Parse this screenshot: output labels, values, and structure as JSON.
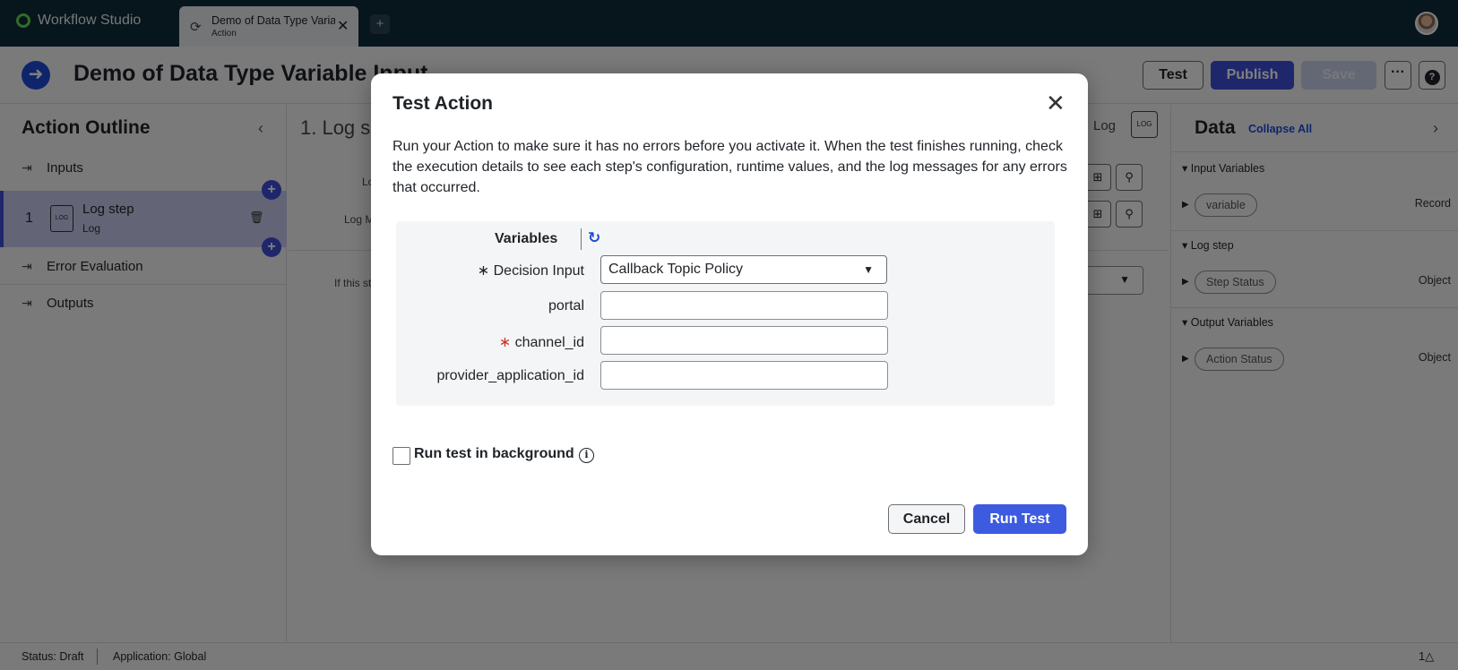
{
  "app": {
    "brand": "Workflow Studio"
  },
  "tabs": [
    {
      "title": "Demo of Data Type Variable Input",
      "subtitle": "Action"
    }
  ],
  "header": {
    "title": "Demo of Data Type Variable Input",
    "test_label": "Test",
    "publish_label": "Publish",
    "save_label": "Save",
    "more_label": "···",
    "help_label": "?"
  },
  "outline": {
    "title": "Action Outline",
    "inputs_label": "Inputs",
    "step": {
      "number": "1",
      "name": "Log step",
      "type": "Log"
    },
    "error_label": "Error Evaluation",
    "outputs_label": "Outputs"
  },
  "center": {
    "step_heading": "1.  Log s",
    "log_level_label": "Lo",
    "log_message_label": "Log M",
    "if_text": "If this st",
    "log_label": "Log"
  },
  "data_panel": {
    "title": "Data",
    "collapse_all": "Collapse All",
    "sections": [
      {
        "heading": "Input Variables",
        "var": "variable",
        "type": "Record"
      },
      {
        "heading": "Log step",
        "var": "Step Status",
        "type": "Object"
      },
      {
        "heading": "Output Variables",
        "var": "Action Status",
        "type": "Object"
      }
    ]
  },
  "status": {
    "status": "Status: Draft",
    "application": "Application: Global",
    "count": "1"
  },
  "modal": {
    "title": "Test Action",
    "description": "Run your Action to make sure it has no errors before you activate it. When the test finishes running, check the execution details to see each step's configuration, runtime values, and the log messages for any errors that occurred.",
    "variables_title": "Variables",
    "fields": {
      "decision_input": {
        "label": "Decision Input",
        "value": "Callback Topic Policy",
        "required": true
      },
      "portal": {
        "label": "portal",
        "value": ""
      },
      "channel_id": {
        "label": "channel_id",
        "value": "",
        "required": true
      },
      "provider_application_id": {
        "label": "provider_application_id",
        "value": ""
      }
    },
    "background_label": "Run test in background",
    "background_checked": false,
    "cancel_label": "Cancel",
    "run_label": "Run Test"
  }
}
